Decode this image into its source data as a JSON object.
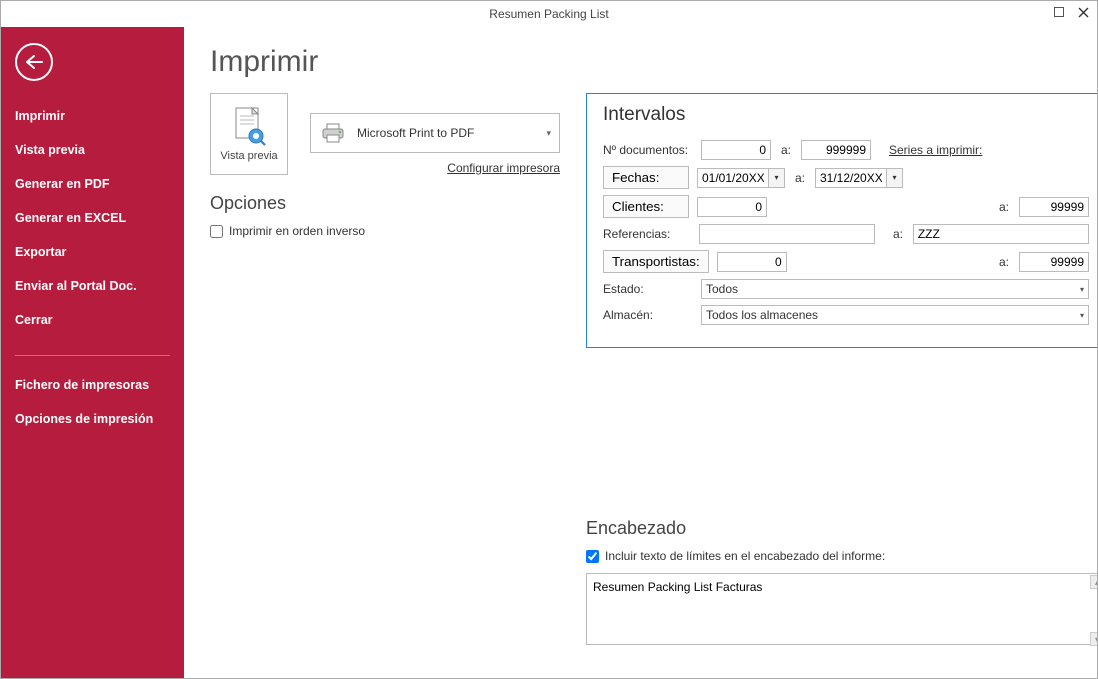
{
  "window": {
    "title": "Resumen Packing List"
  },
  "sidebar": {
    "items": [
      "Imprimir",
      "Vista previa",
      "Generar en PDF",
      "Generar en EXCEL",
      "Exportar",
      "Enviar al Portal Doc.",
      "Cerrar"
    ],
    "items2": [
      "Fichero de impresoras",
      "Opciones de impresión"
    ]
  },
  "page": {
    "heading": "Imprimir",
    "preview_label": "Vista previa",
    "printer_name": "Microsoft Print to PDF",
    "config_printer": "Configurar impresora",
    "options_heading": "Opciones",
    "reverse_order": "Imprimir en orden inverso"
  },
  "intervals": {
    "heading": "Intervalos",
    "docs_label": "Nº documentos:",
    "docs_from": "0",
    "docs_to": "999999",
    "a": "a:",
    "series_link": "Series a imprimir:",
    "dates_btn": "Fechas:",
    "date_from": "01/01/20XX",
    "date_to": "31/12/20XX",
    "clients_btn": "Clientes:",
    "clients_from": "0",
    "clients_to": "99999",
    "refs_label": "Referencias:",
    "refs_from": "",
    "refs_to": "ZZZ",
    "trans_btn": "Transportistas:",
    "trans_from": "0",
    "trans_to": "99999",
    "estado_label": "Estado:",
    "estado_value": "Todos",
    "almacen_label": "Almacén:",
    "almacen_value": "Todos los almacenes"
  },
  "header": {
    "heading": "Encabezado",
    "include_limits": "Incluir texto de límites en el encabezado del informe:",
    "text": "Resumen Packing List Facturas"
  }
}
